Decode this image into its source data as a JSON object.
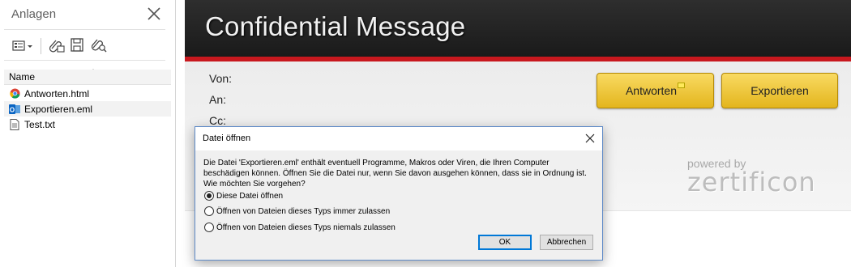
{
  "attachments_pane": {
    "title": "Anlagen",
    "column_header": "Name",
    "files": [
      {
        "name": "Antworten.html",
        "icon": "chrome-icon"
      },
      {
        "name": "Exportieren.eml",
        "icon": "outlook-icon"
      },
      {
        "name": "Test.txt",
        "icon": "text-file-icon"
      }
    ]
  },
  "message": {
    "banner_title": "Confidential Message",
    "header_labels": {
      "from": "Von:",
      "to": "An:",
      "cc": "Cc:"
    },
    "buttons": {
      "reply": "Antworten",
      "export": "Exportieren"
    },
    "powered_by": "powered by",
    "brand": "zertificon"
  },
  "dialog": {
    "title": "Datei öffnen",
    "text": "Die Datei 'Exportieren.eml' enthält eventuell Programme, Makros oder Viren, die Ihren Computer beschädigen können. Öffnen Sie die Datei nur, wenn Sie davon ausgehen können, dass sie in Ordnung ist. Wie möchten Sie vorgehen?",
    "options": [
      {
        "label": "Diese Datei öffnen",
        "checked": true
      },
      {
        "label": "Öffnen von Dateien dieses Typs immer zulassen",
        "checked": false
      },
      {
        "label": "Öffnen von Dateien dieses Typs niemals zulassen",
        "checked": false
      }
    ],
    "ok_label": "OK",
    "cancel_label": "Abbrechen"
  },
  "colors": {
    "banner_red": "#c8181e",
    "button_gold": "#f0c53a",
    "dialog_focus": "#0078d7"
  }
}
